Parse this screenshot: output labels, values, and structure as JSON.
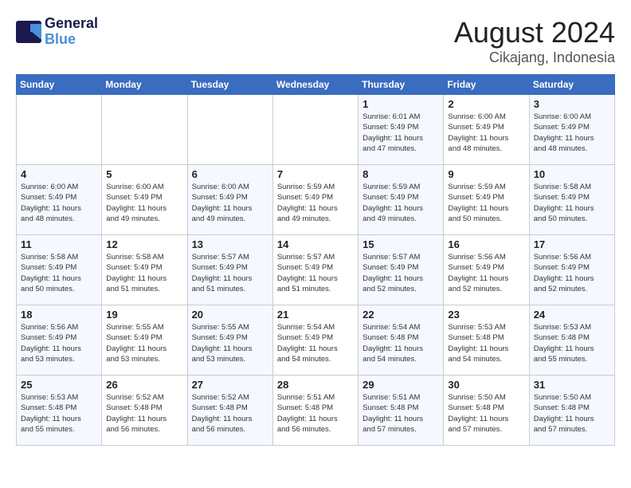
{
  "header": {
    "logo_line1": "General",
    "logo_line2": "Blue",
    "month_year": "August 2024",
    "location": "Cikajang, Indonesia"
  },
  "weekdays": [
    "Sunday",
    "Monday",
    "Tuesday",
    "Wednesday",
    "Thursday",
    "Friday",
    "Saturday"
  ],
  "weeks": [
    [
      {
        "day": "",
        "info": ""
      },
      {
        "day": "",
        "info": ""
      },
      {
        "day": "",
        "info": ""
      },
      {
        "day": "",
        "info": ""
      },
      {
        "day": "1",
        "info": "Sunrise: 6:01 AM\nSunset: 5:49 PM\nDaylight: 11 hours\nand 47 minutes."
      },
      {
        "day": "2",
        "info": "Sunrise: 6:00 AM\nSunset: 5:49 PM\nDaylight: 11 hours\nand 48 minutes."
      },
      {
        "day": "3",
        "info": "Sunrise: 6:00 AM\nSunset: 5:49 PM\nDaylight: 11 hours\nand 48 minutes."
      }
    ],
    [
      {
        "day": "4",
        "info": "Sunrise: 6:00 AM\nSunset: 5:49 PM\nDaylight: 11 hours\nand 48 minutes."
      },
      {
        "day": "5",
        "info": "Sunrise: 6:00 AM\nSunset: 5:49 PM\nDaylight: 11 hours\nand 49 minutes."
      },
      {
        "day": "6",
        "info": "Sunrise: 6:00 AM\nSunset: 5:49 PM\nDaylight: 11 hours\nand 49 minutes."
      },
      {
        "day": "7",
        "info": "Sunrise: 5:59 AM\nSunset: 5:49 PM\nDaylight: 11 hours\nand 49 minutes."
      },
      {
        "day": "8",
        "info": "Sunrise: 5:59 AM\nSunset: 5:49 PM\nDaylight: 11 hours\nand 49 minutes."
      },
      {
        "day": "9",
        "info": "Sunrise: 5:59 AM\nSunset: 5:49 PM\nDaylight: 11 hours\nand 50 minutes."
      },
      {
        "day": "10",
        "info": "Sunrise: 5:58 AM\nSunset: 5:49 PM\nDaylight: 11 hours\nand 50 minutes."
      }
    ],
    [
      {
        "day": "11",
        "info": "Sunrise: 5:58 AM\nSunset: 5:49 PM\nDaylight: 11 hours\nand 50 minutes."
      },
      {
        "day": "12",
        "info": "Sunrise: 5:58 AM\nSunset: 5:49 PM\nDaylight: 11 hours\nand 51 minutes."
      },
      {
        "day": "13",
        "info": "Sunrise: 5:57 AM\nSunset: 5:49 PM\nDaylight: 11 hours\nand 51 minutes."
      },
      {
        "day": "14",
        "info": "Sunrise: 5:57 AM\nSunset: 5:49 PM\nDaylight: 11 hours\nand 51 minutes."
      },
      {
        "day": "15",
        "info": "Sunrise: 5:57 AM\nSunset: 5:49 PM\nDaylight: 11 hours\nand 52 minutes."
      },
      {
        "day": "16",
        "info": "Sunrise: 5:56 AM\nSunset: 5:49 PM\nDaylight: 11 hours\nand 52 minutes."
      },
      {
        "day": "17",
        "info": "Sunrise: 5:56 AM\nSunset: 5:49 PM\nDaylight: 11 hours\nand 52 minutes."
      }
    ],
    [
      {
        "day": "18",
        "info": "Sunrise: 5:56 AM\nSunset: 5:49 PM\nDaylight: 11 hours\nand 53 minutes."
      },
      {
        "day": "19",
        "info": "Sunrise: 5:55 AM\nSunset: 5:49 PM\nDaylight: 11 hours\nand 53 minutes."
      },
      {
        "day": "20",
        "info": "Sunrise: 5:55 AM\nSunset: 5:49 PM\nDaylight: 11 hours\nand 53 minutes."
      },
      {
        "day": "21",
        "info": "Sunrise: 5:54 AM\nSunset: 5:49 PM\nDaylight: 11 hours\nand 54 minutes."
      },
      {
        "day": "22",
        "info": "Sunrise: 5:54 AM\nSunset: 5:48 PM\nDaylight: 11 hours\nand 54 minutes."
      },
      {
        "day": "23",
        "info": "Sunrise: 5:53 AM\nSunset: 5:48 PM\nDaylight: 11 hours\nand 54 minutes."
      },
      {
        "day": "24",
        "info": "Sunrise: 5:53 AM\nSunset: 5:48 PM\nDaylight: 11 hours\nand 55 minutes."
      }
    ],
    [
      {
        "day": "25",
        "info": "Sunrise: 5:53 AM\nSunset: 5:48 PM\nDaylight: 11 hours\nand 55 minutes."
      },
      {
        "day": "26",
        "info": "Sunrise: 5:52 AM\nSunset: 5:48 PM\nDaylight: 11 hours\nand 56 minutes."
      },
      {
        "day": "27",
        "info": "Sunrise: 5:52 AM\nSunset: 5:48 PM\nDaylight: 11 hours\nand 56 minutes."
      },
      {
        "day": "28",
        "info": "Sunrise: 5:51 AM\nSunset: 5:48 PM\nDaylight: 11 hours\nand 56 minutes."
      },
      {
        "day": "29",
        "info": "Sunrise: 5:51 AM\nSunset: 5:48 PM\nDaylight: 11 hours\nand 57 minutes."
      },
      {
        "day": "30",
        "info": "Sunrise: 5:50 AM\nSunset: 5:48 PM\nDaylight: 11 hours\nand 57 minutes."
      },
      {
        "day": "31",
        "info": "Sunrise: 5:50 AM\nSunset: 5:48 PM\nDaylight: 11 hours\nand 57 minutes."
      }
    ]
  ]
}
